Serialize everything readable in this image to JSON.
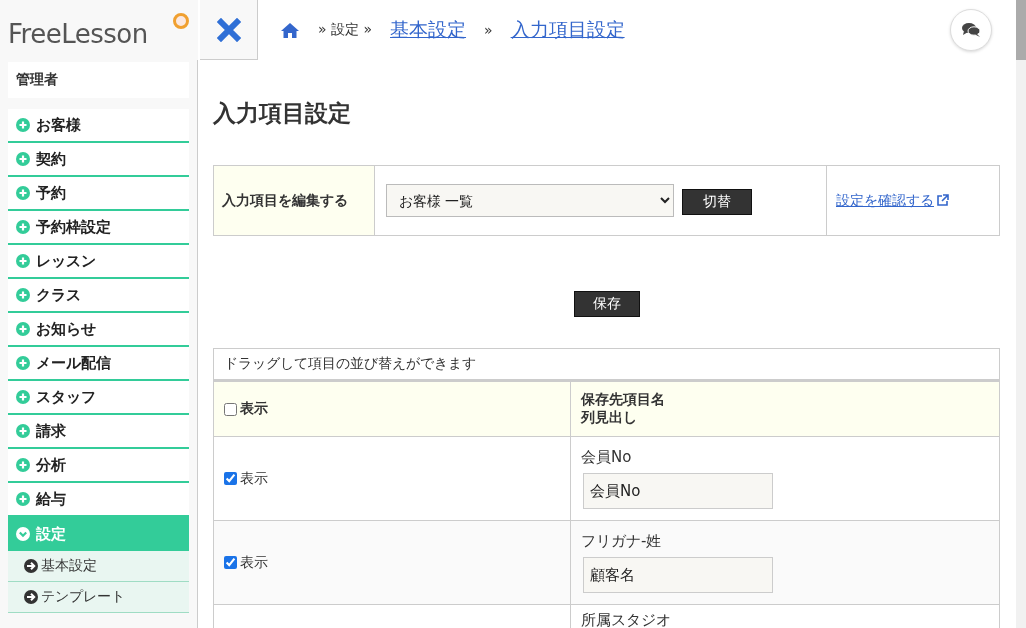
{
  "logo": {
    "text": "FreeLesson"
  },
  "breadcrumb": [
    {
      "text": "» 設定 »",
      "kind": "plain"
    },
    {
      "text": "基本設定",
      "kind": "link"
    },
    {
      "text": "»",
      "kind": "plain"
    },
    {
      "text": "入力項目設定",
      "kind": "link"
    }
  ],
  "sidebar": {
    "user": "管理者",
    "items": [
      {
        "label": "お客様",
        "expanded": false
      },
      {
        "label": "契約",
        "expanded": false
      },
      {
        "label": "予約",
        "expanded": false
      },
      {
        "label": "予約枠設定",
        "expanded": false
      },
      {
        "label": "レッスン",
        "expanded": false
      },
      {
        "label": "クラス",
        "expanded": false
      },
      {
        "label": "お知らせ",
        "expanded": false
      },
      {
        "label": "メール配信",
        "expanded": false
      },
      {
        "label": "スタッフ",
        "expanded": false
      },
      {
        "label": "請求",
        "expanded": false
      },
      {
        "label": "分析",
        "expanded": false
      },
      {
        "label": "給与",
        "expanded": false
      },
      {
        "label": "設定",
        "expanded": true,
        "children": [
          {
            "label": "基本設定"
          },
          {
            "label": "テンプレート"
          }
        ]
      }
    ]
  },
  "page_title": "入力項目設定",
  "editor": {
    "label": "入力項目を編集する",
    "select_value": "お客様 一覧",
    "switch_button": "切替",
    "confirm_link": "設定を確認する"
  },
  "save_button": "保存",
  "table": {
    "caption": "ドラッグして項目の並び替えができます",
    "columns": [
      {
        "label": "表示",
        "checked": false
      },
      {
        "lines": [
          "保存先項目名",
          "列見出し"
        ]
      }
    ],
    "rows": [
      {
        "show_label": "表示",
        "checked": true,
        "field_name": "会員No",
        "heading": "会員No"
      },
      {
        "show_label": "表示",
        "checked": true,
        "field_name": "フリガナ-姓",
        "heading": "顧客名"
      },
      {
        "field_name": "所属スタジオ"
      }
    ]
  }
}
